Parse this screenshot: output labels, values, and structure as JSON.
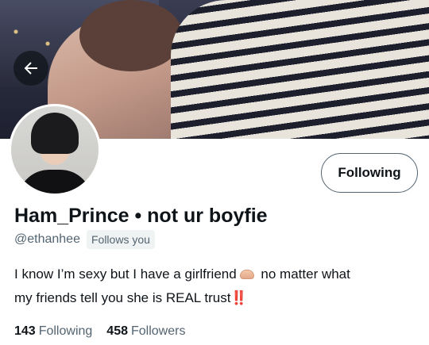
{
  "profile": {
    "display_name": "Ham_Prince • not ur boyfie",
    "handle": "@ethanhee",
    "follows_you_badge": "Follows you",
    "bio_line1_before_emoji": "I know I’m sexy but I have a girlfriend",
    "bio_line1_after_emoji": "no matter what",
    "bio_line2": "my friends tell you she is REAL trust",
    "bio_emoji_1": "heart-hands-emoji",
    "bio_emoji_2": "‼️",
    "follow_button_label": "Following"
  },
  "stats": {
    "following_count": "143",
    "following_label": "Following",
    "followers_count": "458",
    "followers_label": "Followers"
  },
  "icons": {
    "back": "arrow-left-icon"
  },
  "colors": {
    "text_primary": "#0f1419",
    "text_secondary": "#536471",
    "badge_background": "#eff3f4",
    "button_border": "#536471"
  }
}
